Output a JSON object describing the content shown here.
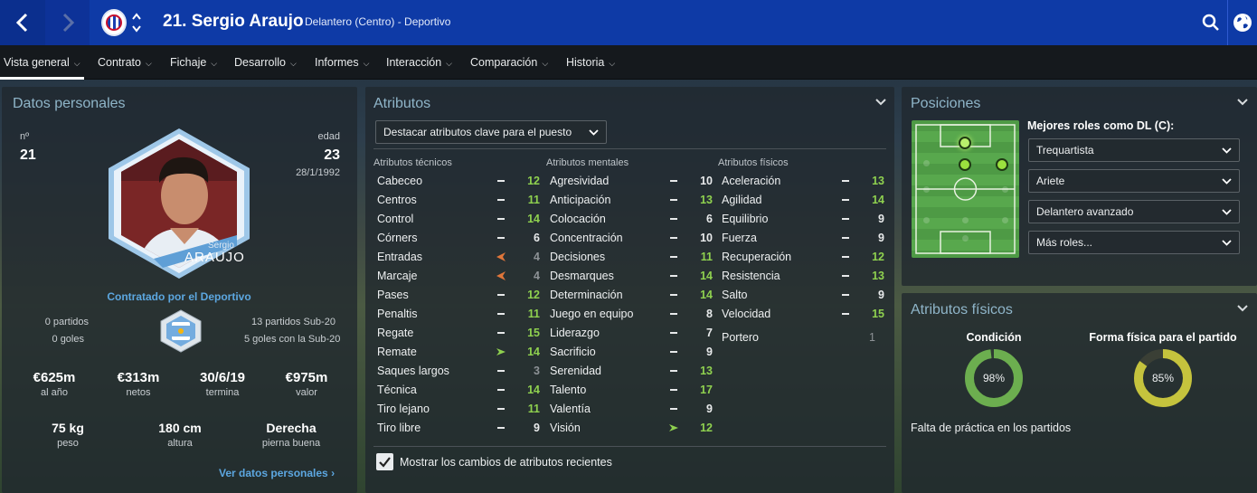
{
  "header": {
    "title": "21. Sergio Araujo",
    "subtitle": "Delantero (Centro) - Deportivo"
  },
  "nav": [
    {
      "label": "Vista general",
      "active": true
    },
    {
      "label": "Contrato"
    },
    {
      "label": "Fichaje"
    },
    {
      "label": "Desarrollo"
    },
    {
      "label": "Informes"
    },
    {
      "label": "Interacción"
    },
    {
      "label": "Comparación"
    },
    {
      "label": "Historia"
    }
  ],
  "personal": {
    "title": "Datos personales",
    "number_label": "nº",
    "number": "21",
    "age_label": "edad",
    "age": "23",
    "birth": "28/1/1992",
    "card_first": "Sergio",
    "card_last": "ARAUJO",
    "contracted": "Contratado por el Deportivo",
    "left_matches": "0 partidos",
    "left_goals": "0 goles",
    "right_matches": "13 partidos Sub-20",
    "right_goals": "5 goles con la Sub-20",
    "stats": [
      {
        "value": "€625m",
        "label": "al año"
      },
      {
        "value": "€313m",
        "label": "netos"
      },
      {
        "value": "30/6/19",
        "label": "termina"
      },
      {
        "value": "€975m",
        "label": "valor"
      }
    ],
    "body": [
      {
        "value": "75 kg",
        "label": "peso"
      },
      {
        "value": "180 cm",
        "label": "altura"
      },
      {
        "value": "Derecha",
        "label": "pierna buena"
      }
    ],
    "link": "Ver datos personales"
  },
  "attributes": {
    "title": "Atributos",
    "highlight": "Destacar atributos clave para el puesto",
    "show_changes": "Mostrar los cambios de atributos recientes",
    "tech_header": "Atributos técnicos",
    "mental_header": "Atributos mentales",
    "phys_header": "Atributos físicos",
    "technical": [
      {
        "name": "Cabeceo",
        "value": "12",
        "trend": "flat",
        "color": "#8fd14f"
      },
      {
        "name": "Centros",
        "value": "11",
        "trend": "flat",
        "color": "#8fd14f"
      },
      {
        "name": "Control",
        "value": "14",
        "trend": "flat",
        "color": "#8fd14f"
      },
      {
        "name": "Córners",
        "value": "6",
        "trend": "flat",
        "color": "#e8eaeb"
      },
      {
        "name": "Entradas",
        "value": "4",
        "trend": "down",
        "color": "#8d9296"
      },
      {
        "name": "Marcaje",
        "value": "4",
        "trend": "down",
        "color": "#8d9296"
      },
      {
        "name": "Pases",
        "value": "12",
        "trend": "flat",
        "color": "#8fd14f"
      },
      {
        "name": "Penaltis",
        "value": "11",
        "trend": "flat",
        "color": "#8fd14f"
      },
      {
        "name": "Regate",
        "value": "15",
        "trend": "flat",
        "color": "#8fd14f"
      },
      {
        "name": "Remate",
        "value": "14",
        "trend": "up",
        "color": "#8fd14f"
      },
      {
        "name": "Saques largos",
        "value": "3",
        "trend": "flat",
        "color": "#8d9296"
      },
      {
        "name": "Técnica",
        "value": "14",
        "trend": "flat",
        "color": "#8fd14f"
      },
      {
        "name": "Tiro lejano",
        "value": "11",
        "trend": "flat",
        "color": "#8fd14f"
      },
      {
        "name": "Tiro libre",
        "value": "9",
        "trend": "flat",
        "color": "#e8eaeb"
      }
    ],
    "mental": [
      {
        "name": "Agresividad",
        "value": "10",
        "trend": "flat",
        "color": "#e8eaeb"
      },
      {
        "name": "Anticipación",
        "value": "13",
        "trend": "flat",
        "color": "#8fd14f"
      },
      {
        "name": "Colocación",
        "value": "6",
        "trend": "flat",
        "color": "#e8eaeb"
      },
      {
        "name": "Concentración",
        "value": "10",
        "trend": "flat",
        "color": "#e8eaeb"
      },
      {
        "name": "Decisiones",
        "value": "11",
        "trend": "flat",
        "color": "#8fd14f"
      },
      {
        "name": "Desmarques",
        "value": "14",
        "trend": "flat",
        "color": "#8fd14f"
      },
      {
        "name": "Determinación",
        "value": "14",
        "trend": "flat",
        "color": "#8fd14f"
      },
      {
        "name": "Juego en equipo",
        "value": "8",
        "trend": "flat",
        "color": "#e8eaeb"
      },
      {
        "name": "Liderazgo",
        "value": "7",
        "trend": "flat",
        "color": "#e8eaeb"
      },
      {
        "name": "Sacrificio",
        "value": "9",
        "trend": "flat",
        "color": "#e8eaeb"
      },
      {
        "name": "Serenidad",
        "value": "13",
        "trend": "flat",
        "color": "#8fd14f"
      },
      {
        "name": "Talento",
        "value": "17",
        "trend": "flat",
        "color": "#8fd14f"
      },
      {
        "name": "Valentía",
        "value": "9",
        "trend": "flat",
        "color": "#e8eaeb"
      },
      {
        "name": "Visión",
        "value": "12",
        "trend": "up",
        "color": "#8fd14f"
      }
    ],
    "physical": [
      {
        "name": "Aceleración",
        "value": "13",
        "trend": "flat",
        "color": "#8fd14f"
      },
      {
        "name": "Agilidad",
        "value": "14",
        "trend": "flat",
        "color": "#8fd14f"
      },
      {
        "name": "Equilibrio",
        "value": "9",
        "trend": "flat",
        "color": "#e8eaeb"
      },
      {
        "name": "Fuerza",
        "value": "9",
        "trend": "flat",
        "color": "#e8eaeb"
      },
      {
        "name": "Recuperación",
        "value": "12",
        "trend": "flat",
        "color": "#8fd14f"
      },
      {
        "name": "Resistencia",
        "value": "13",
        "trend": "flat",
        "color": "#8fd14f"
      },
      {
        "name": "Salto",
        "value": "9",
        "trend": "flat",
        "color": "#e8eaeb"
      },
      {
        "name": "Velocidad",
        "value": "15",
        "trend": "flat",
        "color": "#8fd14f"
      }
    ],
    "goalkeeper_label": "Portero",
    "goalkeeper_value": "1"
  },
  "positions": {
    "title": "Posiciones",
    "roles_label": "Mejores roles como DL (C):",
    "roles": [
      "Trequartista",
      "Ariete",
      "Delantero avanzado",
      "Más roles..."
    ]
  },
  "fitness": {
    "title": "Atributos físicos",
    "condition_label": "Condición",
    "condition_value": "98%",
    "condition": 0.98,
    "match_label": "Forma física para el partido",
    "match_value": "85%",
    "match": 0.85,
    "note": "Falta de práctica en los partidos"
  }
}
